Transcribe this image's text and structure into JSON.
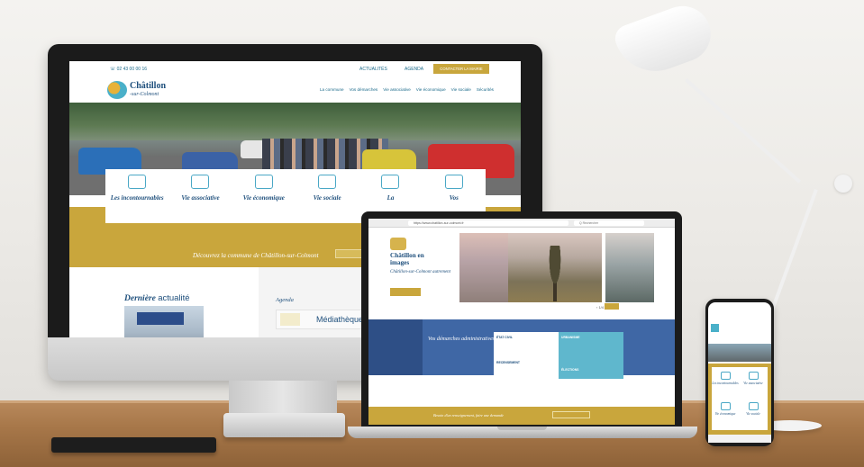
{
  "imac": {
    "phone": "☏ 02 43 00 00 16",
    "top_links": [
      "ACTUALITÉS",
      "AGENDA"
    ],
    "contact_button": "CONTACTER LA MAIRIE",
    "logo": {
      "name": "Châtillon",
      "sub": "-sur-Colmont"
    },
    "nav": [
      "La commune",
      "Vos démarches",
      "Vie associative",
      "Vie économique",
      "Vie sociale",
      "Sécurités"
    ],
    "tiles": [
      "Les incontournables",
      "Vie associative",
      "Vie économique",
      "Vie sociale",
      "La",
      "Vos"
    ],
    "banner_text": "Découvrez la commune de Châtillon-sur-Colmont",
    "news_title_a": "Dernière",
    "news_title_b": "actualité",
    "agenda_label": "Agenda",
    "agenda_item": "Médiathèque"
  },
  "laptop": {
    "url": "https://www.chatillon-sur-colmont.fr",
    "search": "Q  Rechercher",
    "title": "Châtillon en images",
    "subtitle": "Châtillon-sur-Colmont autrement",
    "demarches_title": "Vos démarches administratives",
    "demarches_items": [
      "ÉTAT CIVIL",
      "URBANISME",
      "RECENSEMENT",
      "ÉLECTIONS"
    ],
    "bottom_text": "Besoin d'un renseignement, faire une demande"
  },
  "phone": {
    "tiles": [
      "Les incontournables",
      "Vie associative",
      "Vie économique",
      "Vie sociale"
    ]
  }
}
